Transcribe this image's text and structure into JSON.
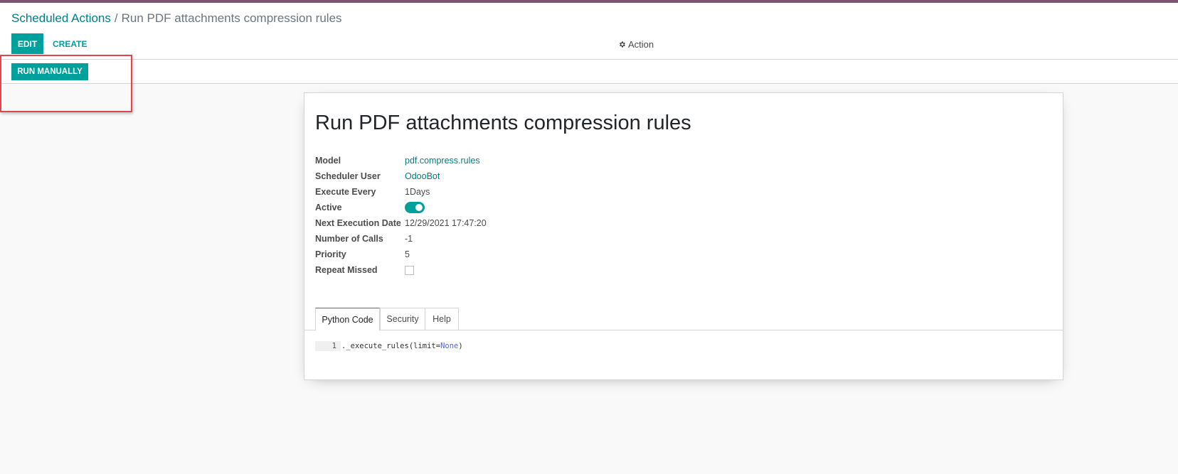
{
  "breadcrumb": {
    "parent": "Scheduled Actions",
    "separator": "/",
    "current": "Run PDF attachments compression rules"
  },
  "toolbar": {
    "edit_label": "EDIT",
    "create_label": "CREATE",
    "action_label": "Action",
    "action_icon": "gear-icon"
  },
  "statusbar": {
    "run_manually_label": "RUN MANUALLY"
  },
  "record": {
    "title": "Run PDF attachments compression rules",
    "fields": {
      "model": {
        "label": "Model",
        "value": "pdf.compress.rules"
      },
      "scheduler_user": {
        "label": "Scheduler User",
        "value": "OdooBot"
      },
      "execute_every": {
        "label": "Execute Every",
        "value": "1Days"
      },
      "active": {
        "label": "Active",
        "value": true
      },
      "next_execution_date": {
        "label": "Next Execution Date",
        "value": "12/29/2021 17:47:20"
      },
      "number_of_calls": {
        "label": "Number of Calls",
        "value": "-1"
      },
      "priority": {
        "label": "Priority",
        "value": "5"
      },
      "repeat_missed": {
        "label": "Repeat Missed",
        "value": false
      }
    }
  },
  "tabs": [
    {
      "label": "Python Code",
      "active": true
    },
    {
      "label": "Security",
      "active": false
    },
    {
      "label": "Help",
      "active": false
    }
  ],
  "code": {
    "line_number": "1",
    "prefix": "._execute_rules(limit=",
    "keyword": "None",
    "suffix": ")"
  },
  "colors": {
    "brand_bar": "#7c5471",
    "primary": "#00a09d",
    "link": "#017e84",
    "highlight": "#e0474c"
  }
}
